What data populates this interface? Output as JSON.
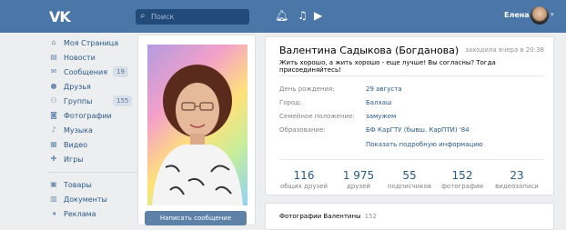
{
  "topbar": {
    "logo": "VK",
    "search_placeholder": "Поиск",
    "user_name": "Елена",
    "icons": [
      "bell-icon",
      "music-icon",
      "play-icon"
    ]
  },
  "nav": {
    "items": [
      {
        "label": "Моя Страница",
        "icon": "home-icon"
      },
      {
        "label": "Новости",
        "icon": "news-icon"
      },
      {
        "label": "Сообщения",
        "icon": "messages-icon",
        "count": "19"
      },
      {
        "label": "Друзья",
        "icon": "friends-icon"
      },
      {
        "label": "Группы",
        "icon": "groups-icon",
        "count": "155"
      },
      {
        "label": "Фотографии",
        "icon": "photos-icon"
      },
      {
        "label": "Музыка",
        "icon": "music-icon"
      },
      {
        "label": "Видео",
        "icon": "video-icon"
      },
      {
        "label": "Игры",
        "icon": "games-icon"
      },
      {
        "label": "Товары",
        "icon": "goods-icon"
      },
      {
        "label": "Документы",
        "icon": "documents-icon"
      },
      {
        "label": "Реклама",
        "icon": "ads-icon"
      }
    ]
  },
  "profile": {
    "name": "Валентина Садыкова (Богданова)",
    "last_seen": "заходила вчера в 20:38",
    "status": "Жить хорошо, а жить хорошо - еще лучше! Вы согласны? Тогда присоединяйтесь!",
    "info": [
      {
        "key": "День рождения:",
        "value": "29 августа"
      },
      {
        "key": "Город:",
        "value": "Балхаш"
      },
      {
        "key": "Семейное положение:",
        "value": "замужем"
      },
      {
        "key": "Образование:",
        "value": "БФ КарГТУ (бывш. КарПТИ) '84"
      }
    ],
    "more_info": "Показать подробную информацию",
    "write_message": "Написать сообщение",
    "counters": [
      {
        "value": "116",
        "label": "общих друзей"
      },
      {
        "value": "1 975",
        "label": "друзей"
      },
      {
        "value": "55",
        "label": "подписчиков"
      },
      {
        "value": "152",
        "label": "фотографии"
      },
      {
        "value": "23",
        "label": "видеозаписи"
      }
    ]
  },
  "photos": {
    "title": "Фотографии Валентины",
    "count": "152"
  },
  "colors": {
    "header": "#4a76a8",
    "link": "#2a5885",
    "background": "#edeef0"
  }
}
